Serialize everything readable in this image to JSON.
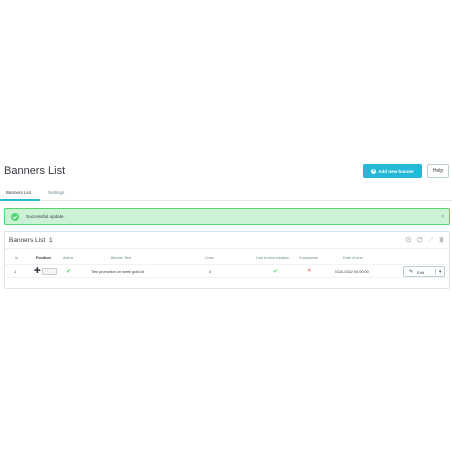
{
  "header": {
    "title": "Banners List",
    "add_button": "Add new banner",
    "help_button": "Help"
  },
  "tabs": [
    {
      "label": "Banners List",
      "active": true
    },
    {
      "label": "Settings",
      "active": false
    }
  ],
  "alert": {
    "message": "Successful update.",
    "close": "×"
  },
  "panel": {
    "title": "Banners List",
    "count": "1",
    "tools": [
      "settings-icon",
      "refresh-icon",
      "sql-icon",
      "trash-icon"
    ]
  },
  "table": {
    "columns": [
      "Id",
      "Position",
      "Active",
      "Banner Text",
      "Links",
      "Link in new window",
      "Countdown",
      "Date of end"
    ],
    "rows": [
      {
        "id": "1",
        "active": "✔",
        "text": "Test promotion on week gold kit",
        "links": "4",
        "new_window": "✔",
        "countdown": "✕",
        "date_end": "0110-0322 00:00:00",
        "action": "Edit"
      }
    ]
  },
  "colors": {
    "accent": "#25b9d7",
    "success": "#53d572",
    "success_bg": "#cbf2d4",
    "danger": "#e15857"
  }
}
